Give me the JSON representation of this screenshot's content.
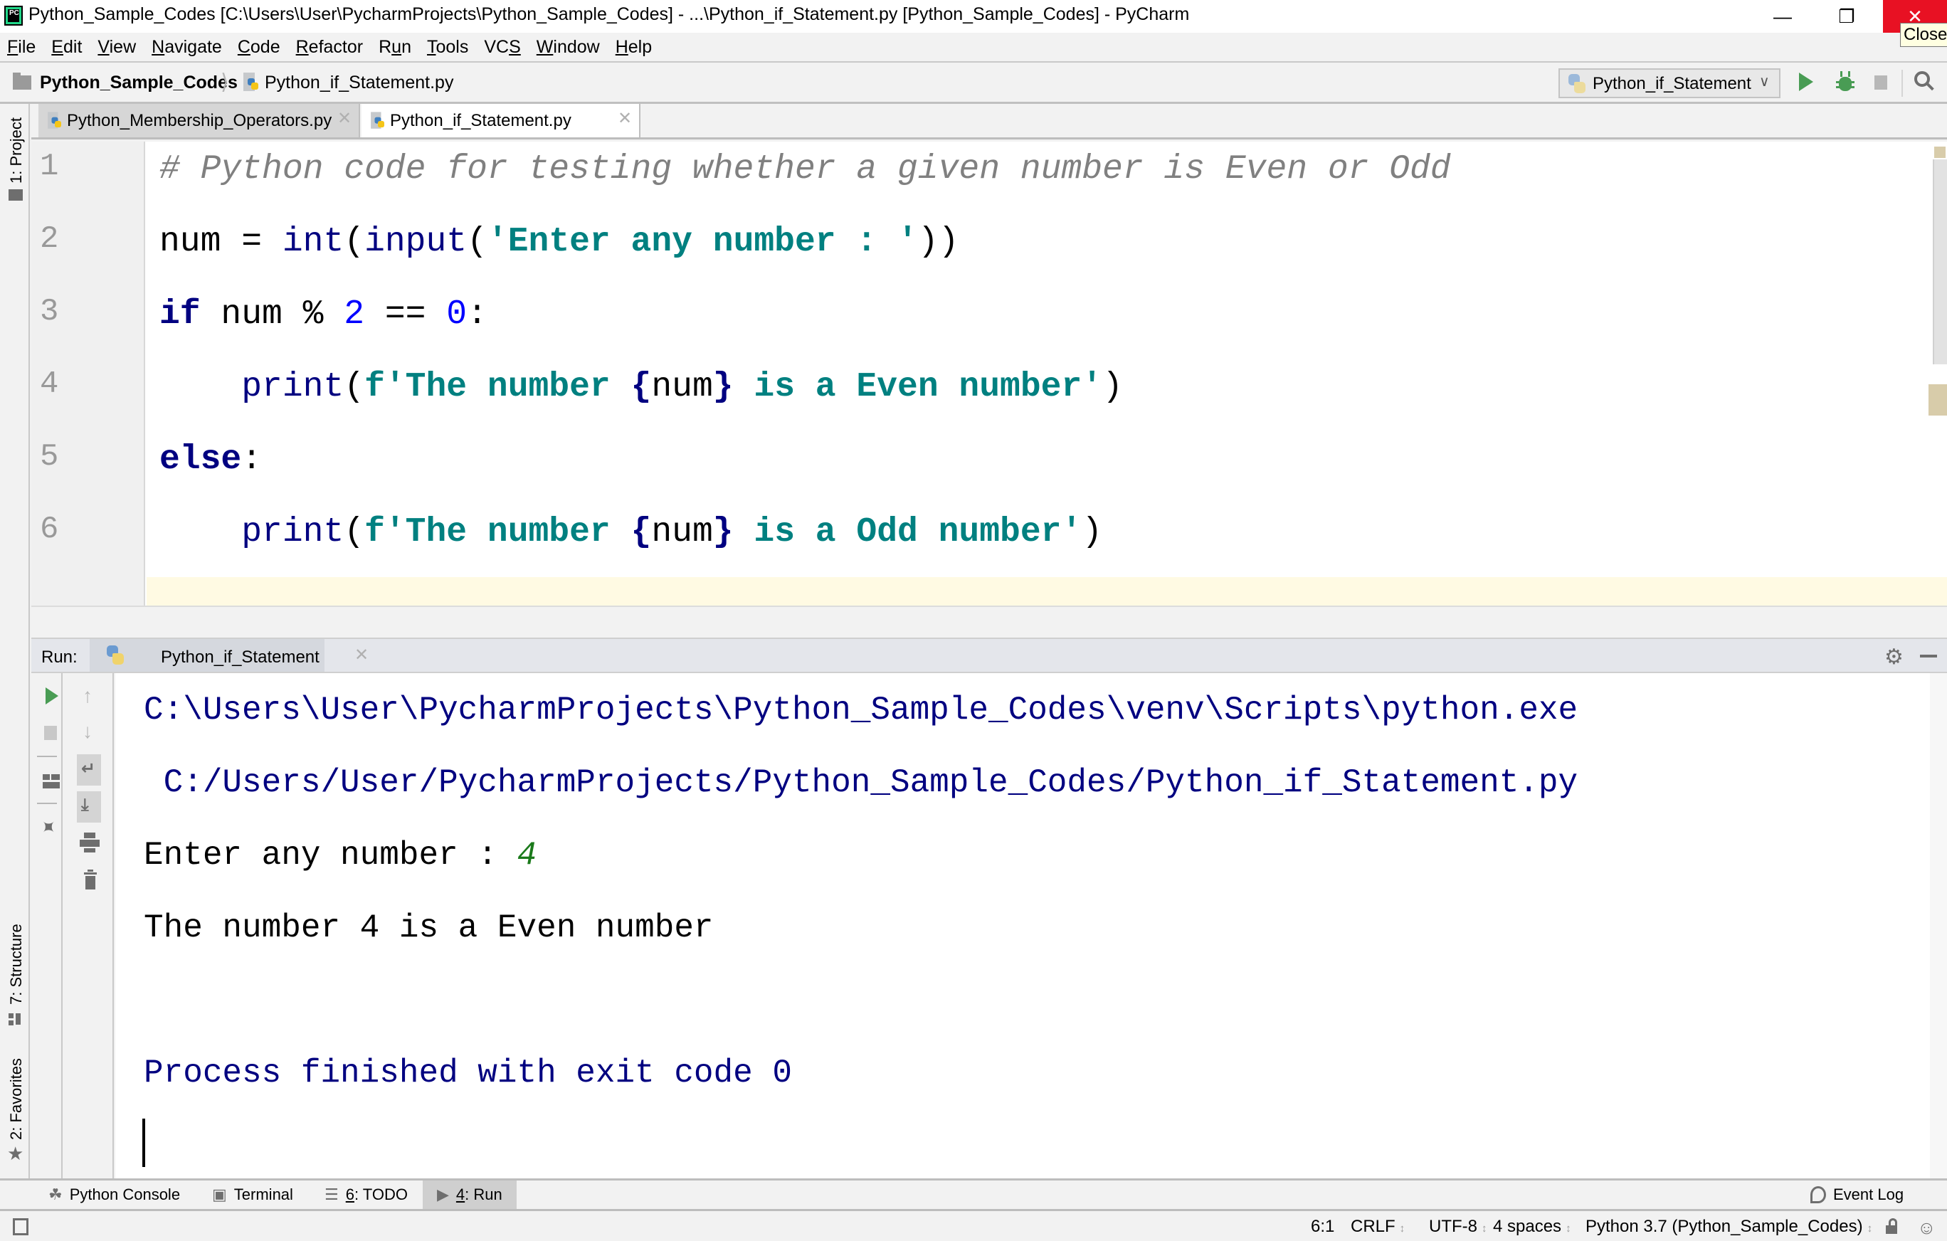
{
  "window": {
    "app_icon_label": "PC",
    "title": "Python_Sample_Codes [C:\\Users\\User\\PycharmProjects\\Python_Sample_Codes] - ...\\Python_if_Statement.py [Python_Sample_Codes] - PyCharm",
    "minimize_glyph": "—",
    "maximize_glyph": "❐",
    "close_glyph": "✕",
    "close_tooltip": "Close"
  },
  "menu": {
    "items": [
      {
        "label": "File",
        "mnemonic": "F",
        "rest": "ile"
      },
      {
        "label": "Edit",
        "mnemonic": "E",
        "rest": "dit"
      },
      {
        "label": "View",
        "mnemonic": "V",
        "rest": "iew"
      },
      {
        "label": "Navigate",
        "mnemonic": "N",
        "rest": "avigate"
      },
      {
        "label": "Code",
        "mnemonic": "C",
        "rest": "ode"
      },
      {
        "label": "Refactor",
        "mnemonic": "R",
        "rest": "efactor"
      },
      {
        "label": "Run",
        "pre": "R",
        "mnemonic": "u",
        "rest": "n"
      },
      {
        "label": "Tools",
        "mnemonic": "T",
        "rest": "ools"
      },
      {
        "label": "VCS",
        "pre": "VC",
        "mnemonic": "S",
        "rest": ""
      },
      {
        "label": "Window",
        "mnemonic": "W",
        "rest": "indow"
      },
      {
        "label": "Help",
        "mnemonic": "H",
        "rest": "elp"
      }
    ]
  },
  "navbar": {
    "project": "Python_Sample_Codes",
    "separator": "⟩",
    "file": "Python_if_Statement.py",
    "run_config": "Python_if_Statement",
    "run_config_chevron": "∨"
  },
  "sidebar": {
    "project_tab": "1: Project",
    "structure_tab": "7: Structure",
    "favorites_tab": "2: Favorites",
    "favorites_icon": "★"
  },
  "editor": {
    "tabs": [
      {
        "label": "Python_Membership_Operators.py",
        "active": false,
        "close": "✕"
      },
      {
        "label": "Python_if_Statement.py",
        "active": true,
        "close": "✕"
      }
    ],
    "lines": [
      {
        "number": "1",
        "tokens": [
          {
            "t": "# Python code for testing whether a given number is Even or Odd",
            "c": "comment"
          }
        ]
      },
      {
        "number": "2",
        "tokens": [
          {
            "t": "num = ",
            "c": "var"
          },
          {
            "t": "int",
            "c": "builtin"
          },
          {
            "t": "(",
            "c": "var"
          },
          {
            "t": "input",
            "c": "builtin"
          },
          {
            "t": "(",
            "c": "var"
          },
          {
            "t": "'Enter any number : '",
            "c": "string"
          },
          {
            "t": "))",
            "c": "var"
          }
        ]
      },
      {
        "number": "3",
        "tokens": [
          {
            "t": "if",
            "c": "kw"
          },
          {
            "t": " num % ",
            "c": "var"
          },
          {
            "t": "2",
            "c": "num"
          },
          {
            "t": " == ",
            "c": "var"
          },
          {
            "t": "0",
            "c": "num"
          },
          {
            "t": ":",
            "c": "var"
          }
        ]
      },
      {
        "number": "4",
        "tokens": [
          {
            "t": "    ",
            "c": "var"
          },
          {
            "t": "print",
            "c": "builtin"
          },
          {
            "t": "(",
            "c": "var"
          },
          {
            "t": "f'The number ",
            "c": "string"
          },
          {
            "t": "{",
            "c": "brace"
          },
          {
            "t": "num",
            "c": "var"
          },
          {
            "t": "}",
            "c": "brace"
          },
          {
            "t": " is a Even number'",
            "c": "string"
          },
          {
            "t": ")",
            "c": "var"
          }
        ]
      },
      {
        "number": "5",
        "tokens": [
          {
            "t": "else",
            "c": "kw"
          },
          {
            "t": ":",
            "c": "var"
          }
        ]
      },
      {
        "number": "6",
        "tokens": [
          {
            "t": "    ",
            "c": "var"
          },
          {
            "t": "print",
            "c": "builtin"
          },
          {
            "t": "(",
            "c": "var"
          },
          {
            "t": "f'The number ",
            "c": "string"
          },
          {
            "t": "{",
            "c": "brace"
          },
          {
            "t": "num",
            "c": "var"
          },
          {
            "t": "}",
            "c": "brace"
          },
          {
            "t": " is a Odd number'",
            "c": "string"
          },
          {
            "t": ")",
            "c": "var"
          }
        ]
      }
    ]
  },
  "run_panel": {
    "label": "Run:",
    "tab": "Python_if_Statement",
    "tab_close": "✕",
    "gear_glyph": "⚙",
    "tools": {
      "up_glyph": "↑",
      "down_glyph": "↓",
      "wrap_glyph": "↵",
      "scroll_glyph": "⤓",
      "pin_glyph": "✦"
    },
    "console": {
      "interpreter_path": "C:\\Users\\User\\PycharmProjects\\Python_Sample_Codes\\venv\\Scripts\\python.exe",
      "script_path": " C:/Users/User/PycharmProjects/Python_Sample_Codes/Python_if_Statement.py",
      "prompt": "Enter any number : ",
      "user_input": "4",
      "output": "The number 4 is a Even number",
      "exit_message": "Process finished with exit code 0"
    }
  },
  "bottom_tabs": {
    "python_console": "Python Console",
    "python_console_icon": "☘",
    "terminal": "Terminal",
    "terminal_icon": "▣",
    "todo_num": "6",
    "todo": ": TODO",
    "todo_icon": "☰",
    "run_num": "4",
    "run": ": Run",
    "run_icon": "▶",
    "event_log": "Event Log"
  },
  "status": {
    "position": "6:1",
    "line_separator": "CRLF",
    "encoding": "UTF-8",
    "indent": "4 spaces",
    "interpreter": "Python 3.7 (Python_Sample_Codes)",
    "updown_glyph": "↕",
    "inspector_glyph": "☺"
  },
  "colors": {
    "accent_green": "#499c54",
    "close_red": "#e81123",
    "string_teal": "#008080",
    "keyword_navy": "#000080",
    "comment_gray": "#808080",
    "input_green": "#1b7a1b"
  }
}
